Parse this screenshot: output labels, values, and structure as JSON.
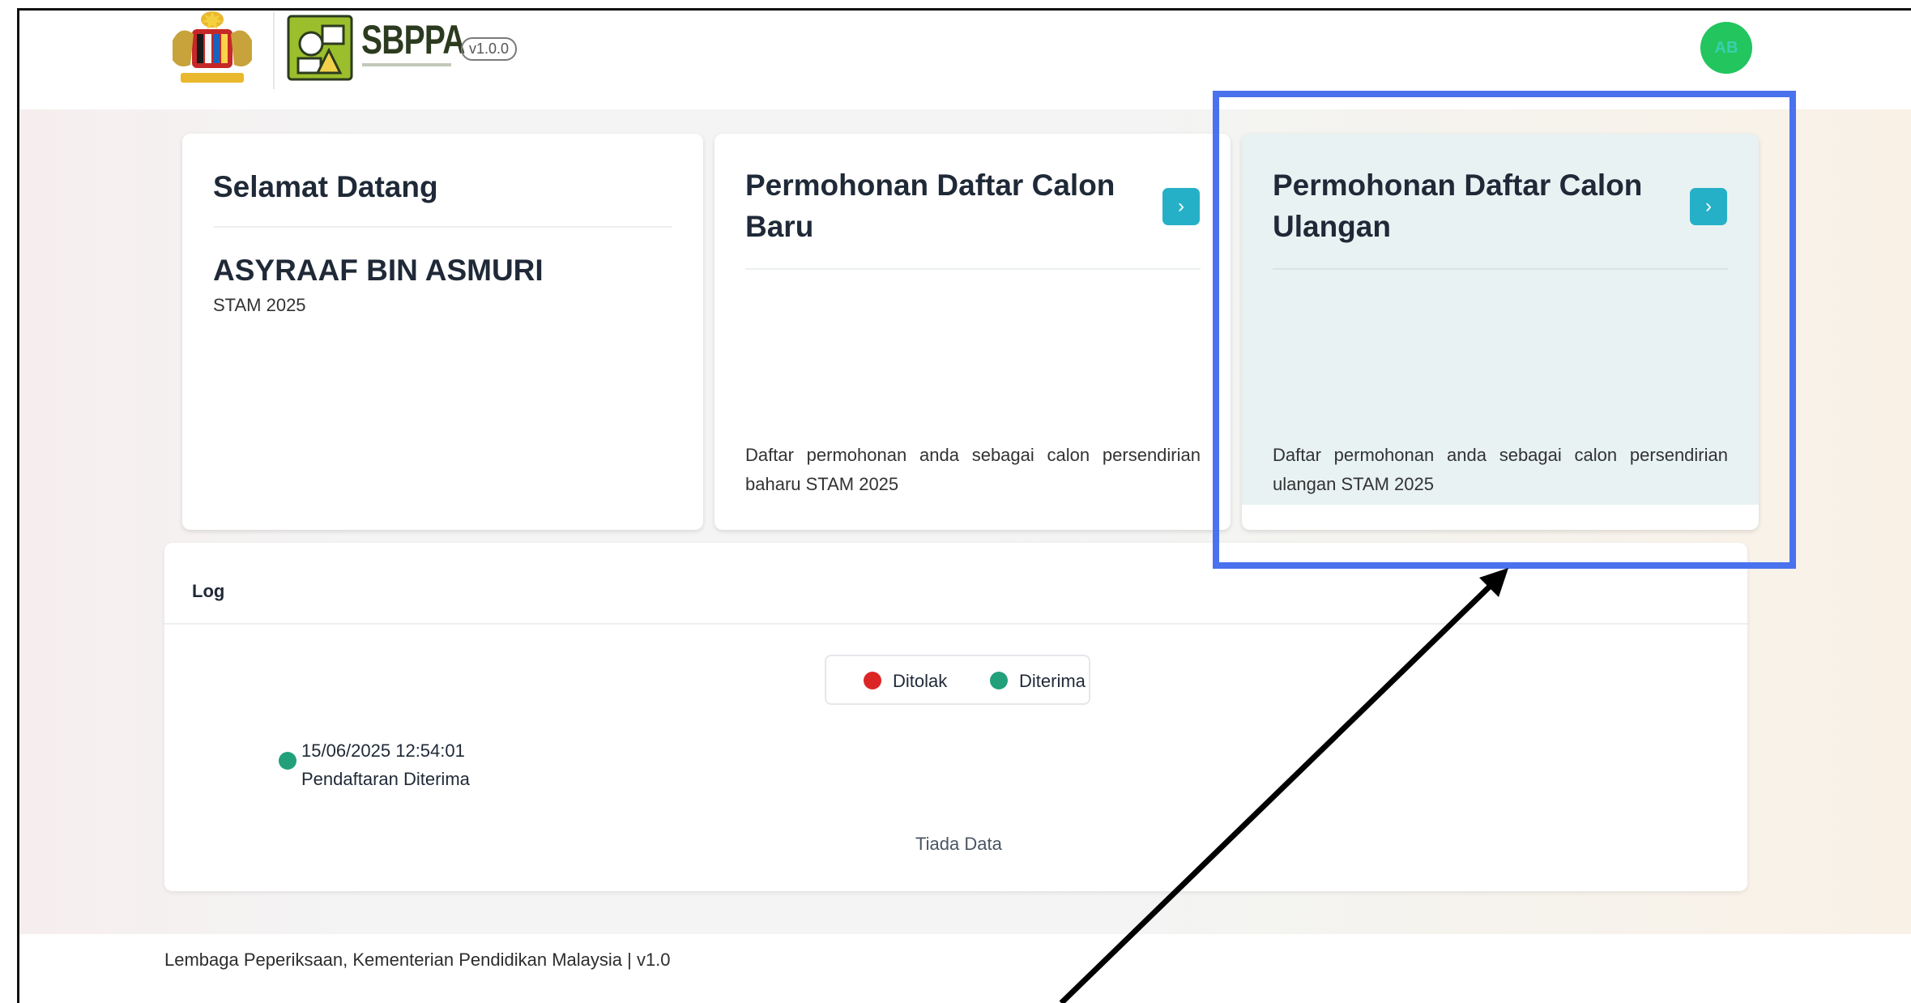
{
  "header": {
    "brand": "SBPPA",
    "version": "v1.0.0",
    "avatar_initials": "AB"
  },
  "welcome_card": {
    "heading": "Selamat Datang",
    "user_name": "ASYRAAF BIN ASMURI",
    "exam": "STAM 2025"
  },
  "new_card": {
    "title_line1": "Permohonan Daftar Calon",
    "title_line2": "Baru",
    "description": "Daftar permohonan anda sebagai calon persendirian baharu STAM 2025",
    "button_icon": "chevron-right-icon"
  },
  "repeat_card": {
    "title_line1": "Permohonan Daftar Calon",
    "title_line2": "Ulangan",
    "description": "Daftar permohonan anda sebagai calon persendirian ulangan STAM 2025",
    "button_icon": "chevron-right-icon"
  },
  "log": {
    "title": "Log",
    "legend": [
      {
        "label": "Ditolak",
        "color": "#dc2626"
      },
      {
        "label": "Diterima",
        "color": "#22a07a"
      }
    ],
    "entries": [
      {
        "datetime": "15/06/2025 12:54:01",
        "status": "Pendaftaran Diterima",
        "color": "#22a07a"
      }
    ],
    "empty_text": "Tiada Data"
  },
  "footer": {
    "text": "Lembaga Peperiksaan, Kementerian Pendidikan Malaysia | v1.0"
  },
  "colors": {
    "accent": "#26b0c7",
    "highlight": "#4a72ee",
    "avatar": "#22c55e"
  }
}
